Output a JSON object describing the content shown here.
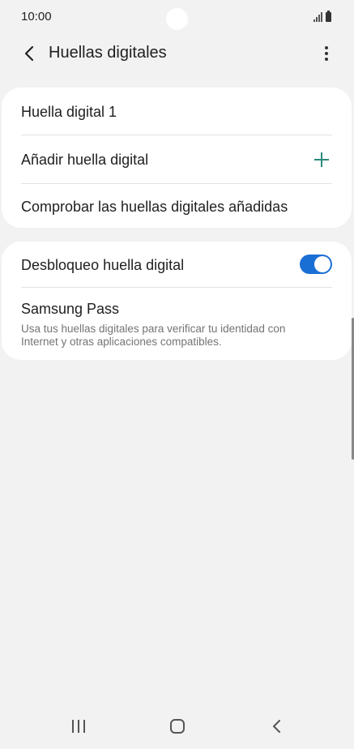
{
  "status_bar": {
    "time": "10:00"
  },
  "header": {
    "title": "Huellas digitales"
  },
  "fingerprints": {
    "items": [
      {
        "label": "Huella digital 1"
      },
      {
        "label": "Añadir huella digital"
      },
      {
        "label": "Comprobar las huellas digitales añadidas"
      }
    ]
  },
  "options": {
    "unlock": {
      "label": "Desbloqueo huella digital",
      "enabled": true
    },
    "samsung_pass": {
      "label": "Samsung Pass",
      "description": "Usa tus huellas digitales para verificar tu identidad con Internet y otras aplicaciones compatibles."
    }
  },
  "colors": {
    "accent": "#1a6fd4",
    "plus": "#2a8a7c",
    "background": "#f2f2f2",
    "card": "#ffffff"
  }
}
